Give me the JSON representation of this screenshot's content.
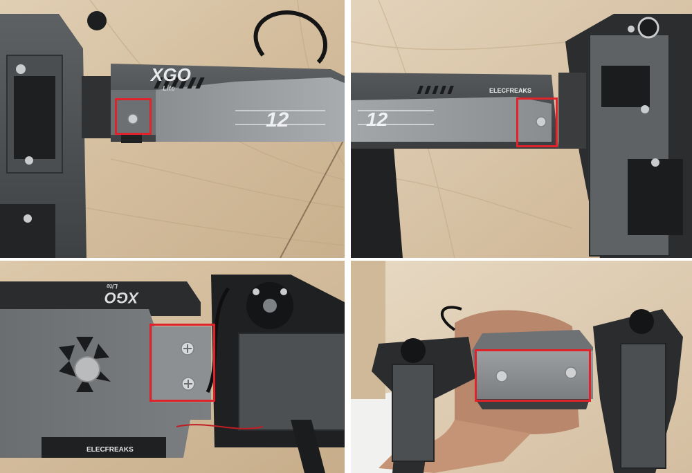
{
  "panels": [
    {
      "label_top": "XGO",
      "label_sub": "Lite",
      "badge": "12"
    },
    {
      "brand": "ELECFREAKS",
      "badge": "12"
    },
    {
      "label_top": "XGO",
      "label_sub": "Lite",
      "brand": "ELECFREAKS"
    },
    {}
  ],
  "colors": {
    "highlight": "#e0232b",
    "wood": "#d7c3a5",
    "metal": "#6d7072",
    "metal_light": "#b9bcbf",
    "dark": "#2b2d2f"
  }
}
